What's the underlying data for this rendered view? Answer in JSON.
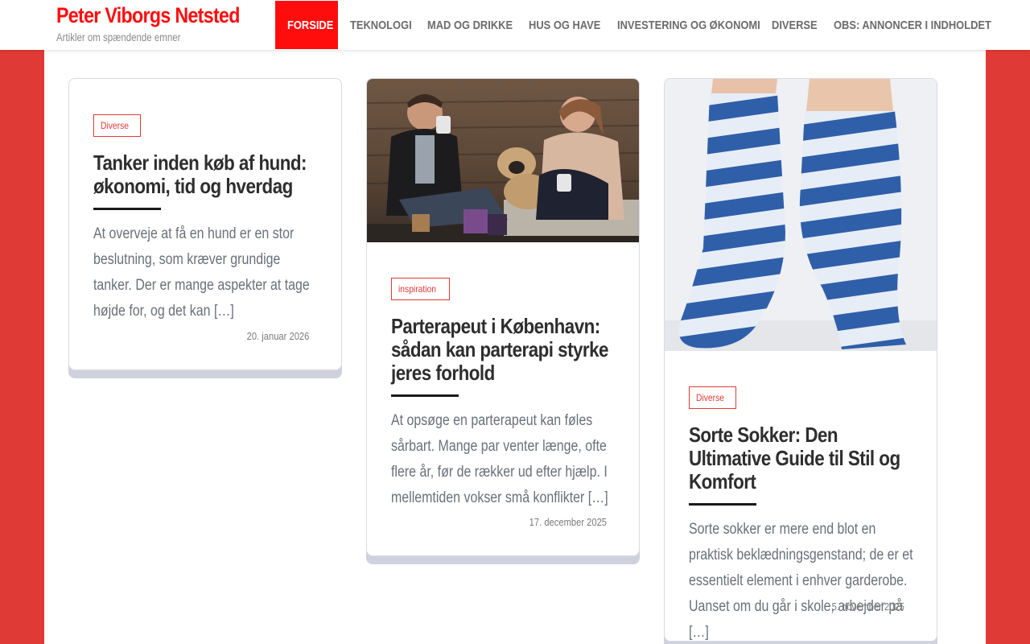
{
  "site": {
    "title": "Peter Viborgs Netsted",
    "tagline": "Artikler om spændende emner"
  },
  "nav": {
    "items": [
      {
        "label": "FORSIDE",
        "active": true
      },
      {
        "label": "TEKNOLOGI"
      },
      {
        "label": "MAD OG DRIKKE"
      },
      {
        "label": "HUS OG HAVE"
      },
      {
        "label": "INVESTERING OG ØKONOMI"
      },
      {
        "label": "DIVERSE"
      },
      {
        "label": "OBS: ANNONCER I INDHOLDET"
      }
    ]
  },
  "posts": [
    {
      "category": "Diverse",
      "title": "Tanker inden køb af hund: økonomi, tid og hverdag",
      "excerpt": "At overveje at få en hund er en stor beslutning, som kræver grundige tanker. Der er mange aspekter at tage højde for, og det kan […]",
      "date": "20. januar 2026"
    },
    {
      "category": "inspiration",
      "title": "Parterapeut i København: sådan kan parterapi styrke jeres forhold",
      "excerpt": "At opsøge en parterapeut kan føles sårbart. Mange par venter længe, ofte flere år, før de rækker ud efter hjælp. I mellemtiden vokser små konflikter […]",
      "date": "17. december 2025"
    },
    {
      "category": "Diverse",
      "title": "Sorte Sokker: Den Ultimative Guide til Stil og Komfort",
      "excerpt": "Sorte sokker er mere end blot en praktisk beklædningsgenstand; de er et essentielt element i enhver garderobe. Uanset om du går i skole, arbejder på […]",
      "date": "5. november 2025"
    }
  ],
  "colors": {
    "accent": "#ff0d0d",
    "background": "#e03a36",
    "card_shadow": "#cfd2de"
  }
}
